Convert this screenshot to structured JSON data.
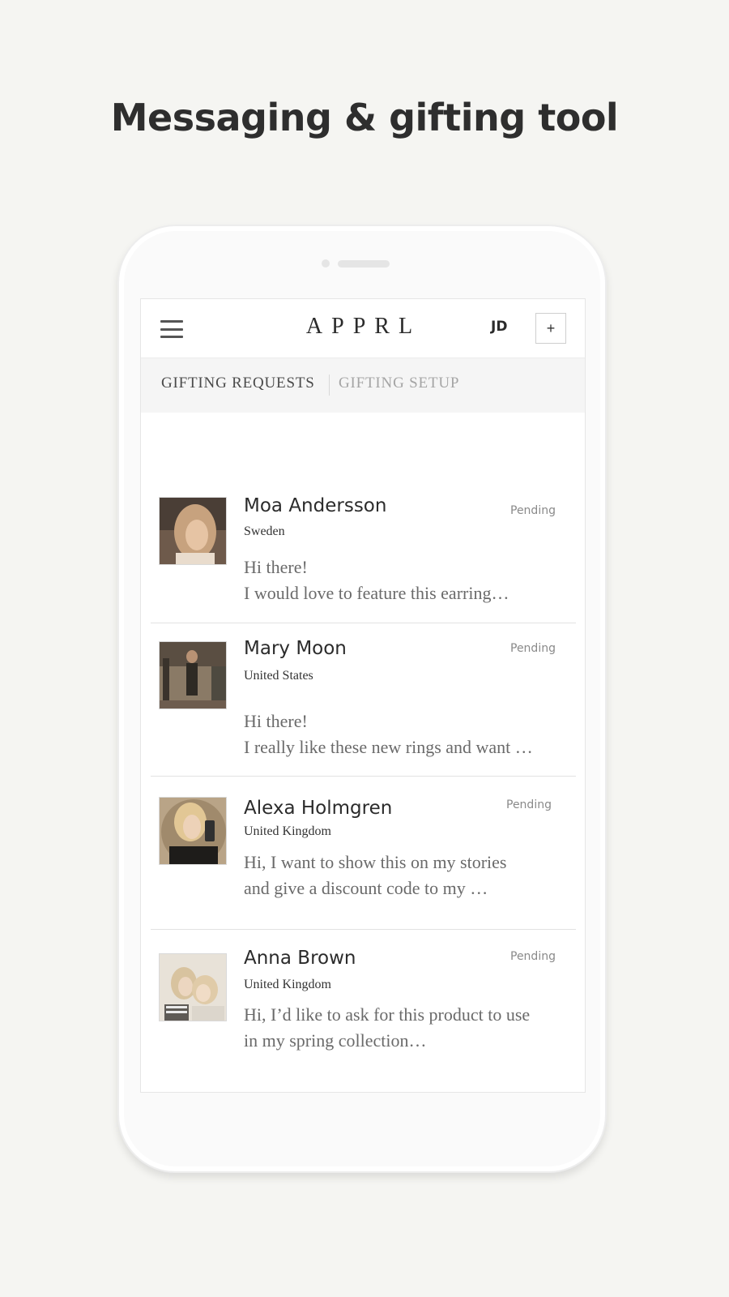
{
  "headline": "Messaging & gifting tool",
  "app": {
    "logo": "APPRL",
    "user_initials": "JD",
    "add_label": "+"
  },
  "tabs": [
    {
      "label": "GIFTING REQUESTS",
      "active": true
    },
    {
      "label": "GIFTING SETUP",
      "active": false
    }
  ],
  "requests": [
    {
      "name": "Moa Andersson",
      "country": "Sweden",
      "status": "Pending",
      "message_lines": [
        "Hi there!",
        "I would love to feature this earring…"
      ],
      "avatar_colors": [
        "#b89a7e",
        "#5c4b3f",
        "#e3c9b0"
      ]
    },
    {
      "name": "Mary Moon",
      "country": "United States",
      "status": "Pending",
      "message_lines": [
        "Hi there!",
        "I really like these new rings and want …"
      ],
      "avatar_colors": [
        "#7a6652",
        "#3d342b",
        "#a8946f"
      ]
    },
    {
      "name": "Alexa Holmgren",
      "country": "United Kingdom",
      "status": "Pending",
      "message_lines": [
        "Hi, I want to show this on my stories",
        "and give a discount code to my …"
      ],
      "avatar_colors": [
        "#c9b08a",
        "#2a2522",
        "#e8d3b3"
      ]
    },
    {
      "name": "Anna Brown",
      "country": "United Kingdom",
      "status": "Pending",
      "message_lines": [
        "Hi, I’d like to ask for this product to use",
        "in my spring collection…"
      ],
      "avatar_colors": [
        "#d7cfc4",
        "#8d8479",
        "#f1ece4"
      ]
    }
  ]
}
